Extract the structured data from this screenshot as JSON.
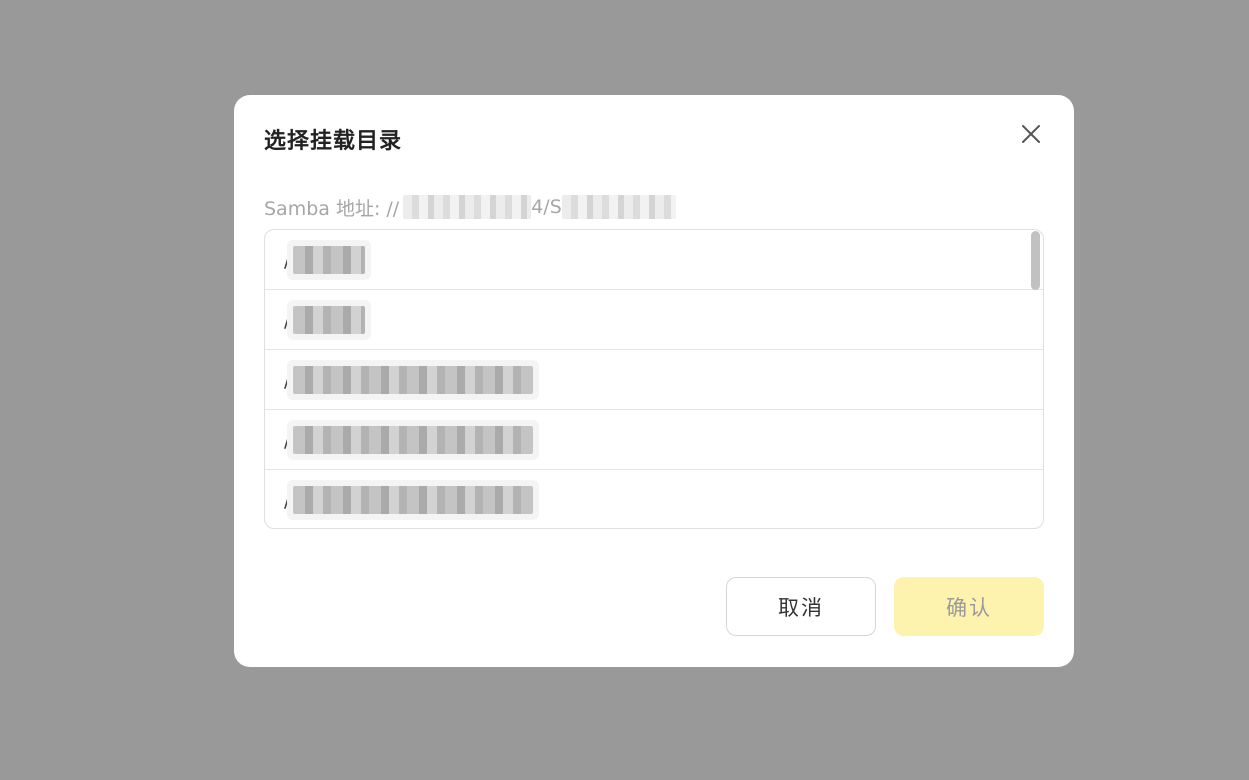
{
  "dialog": {
    "title": "选择挂载目录",
    "close_icon": "close-icon",
    "samba": {
      "label": "Samba 地址: //",
      "mid_text": "4/S"
    },
    "directories": [
      {
        "prefix": "/"
      },
      {
        "prefix": "/"
      },
      {
        "prefix": "/"
      },
      {
        "prefix": "/"
      },
      {
        "prefix": "/"
      }
    ],
    "cancel_label": "取消",
    "confirm_label": "确认"
  },
  "colors": {
    "backdrop": "#999999",
    "confirm_bg": "#fdf3ae",
    "confirm_text": "#9a9a9a"
  }
}
